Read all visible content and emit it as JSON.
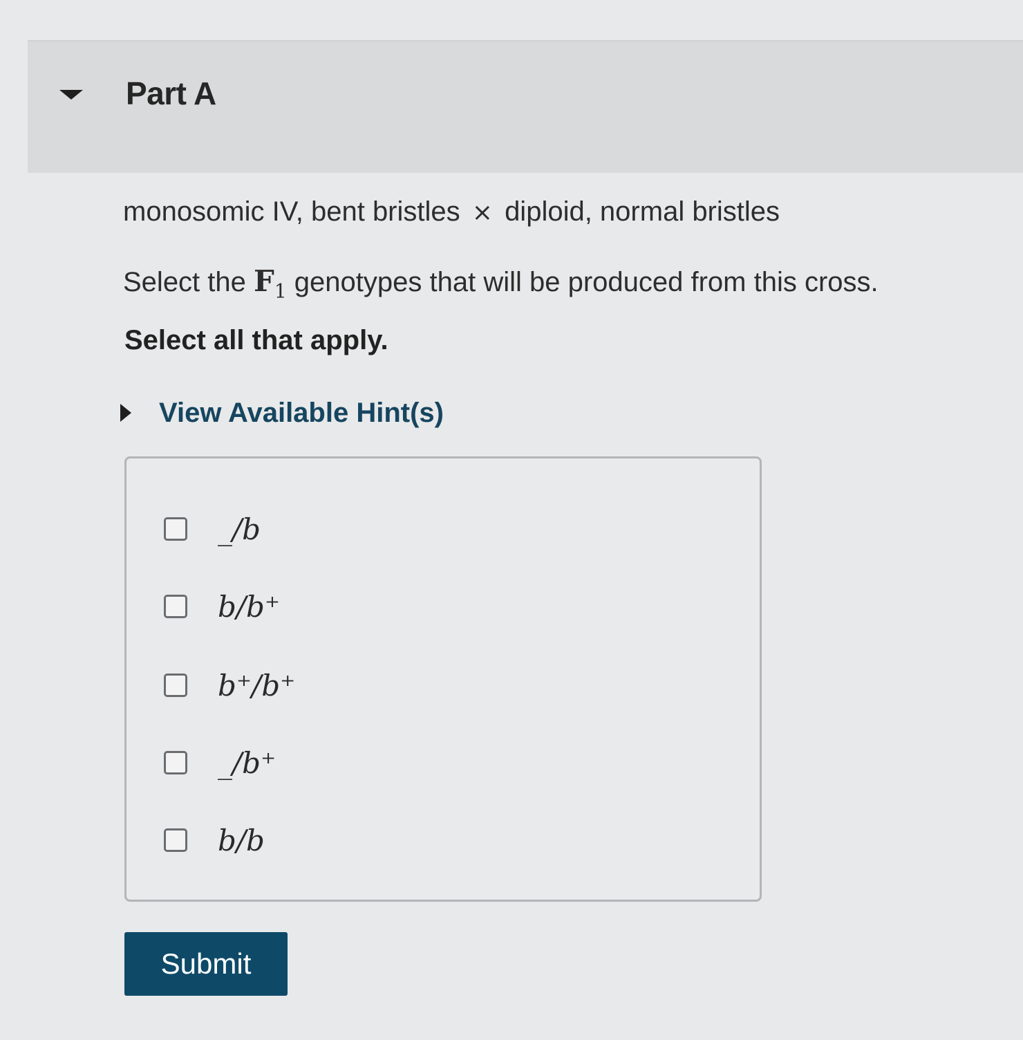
{
  "part": {
    "title": "Part A",
    "collapse_icon": "caret-down-icon"
  },
  "problem": {
    "cross_left": "monosomic IV, bent bristles",
    "cross_symbol": "×",
    "cross_right": "diploid, normal bristles",
    "question_prefix": "Select the ",
    "question_math_base": "F",
    "question_math_sub": "1",
    "question_suffix": " genotypes that will be produced from this cross.",
    "instruction": "Select all that apply."
  },
  "hints": {
    "label": "View Available Hint(s)",
    "icon": "caret-right-icon"
  },
  "options": [
    {
      "label": "_/b",
      "checked": false
    },
    {
      "label": "b/b⁺",
      "checked": false
    },
    {
      "label": "b⁺/b⁺",
      "checked": false
    },
    {
      "label": "_/b⁺",
      "checked": false
    },
    {
      "label": "b/b",
      "checked": false
    }
  ],
  "submit": {
    "label": "Submit"
  },
  "colors": {
    "submit_background": "#0e4a68",
    "hint_link": "#164560",
    "header_band": "#d9dadb",
    "page_background": "#e8e9ea"
  }
}
